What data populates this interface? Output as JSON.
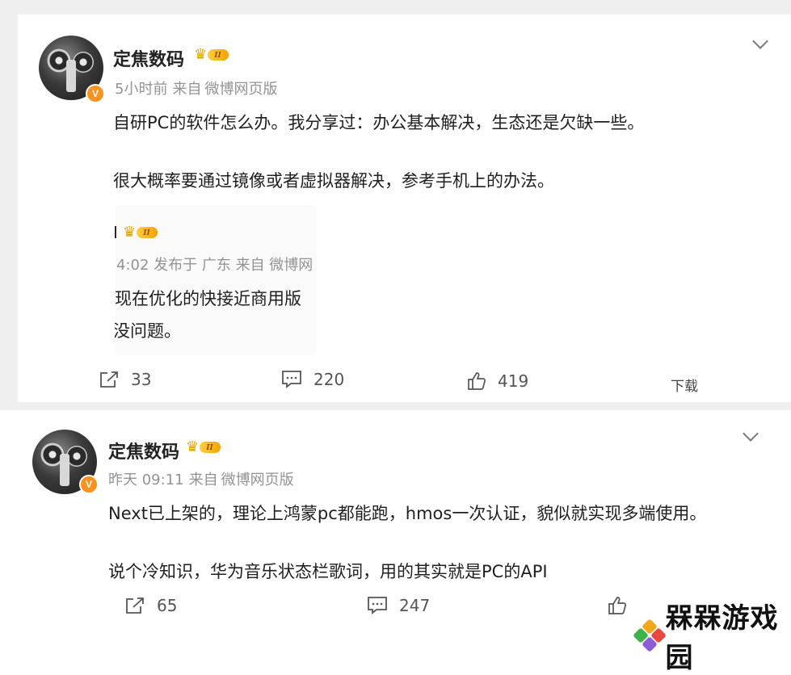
{
  "posts": [
    {
      "author": "定焦数码",
      "vip_level": "II",
      "time": "5小时前",
      "source_prefix": "来自",
      "source": "微博网页版",
      "paragraphs": [
        "自研PC的软件怎么办。我分享过：办公基本解决，生态还是欠缺一些。",
        "很大概率要通过镜像或者虚拟器解决，参考手机上的办法。"
      ],
      "quote": {
        "name_fragment": "I",
        "vip_level": "II",
        "meta": "4:02 发布于 广东 来自 微博网",
        "lines": [
          " 现在优化的快接近商用版",
          "没问题。"
        ]
      },
      "reposts": "33",
      "comments": "220",
      "likes": "419",
      "download_label": "下载"
    },
    {
      "author": "定焦数码",
      "vip_level": "II",
      "time": "昨天 09:11",
      "source_prefix": "来自",
      "source": "微博网页版",
      "paragraphs": [
        "Next已上架的，理论上鸿蒙pc都能跑，hmos一次认证，貌似就实现多端使用。",
        "说个冷知识，华为音乐状态栏歌词，用的其实就是PC的API"
      ],
      "reposts": "65",
      "comments": "247"
    }
  ],
  "watermark": "槑槑游戏园",
  "colors": {
    "badge": "#f7931e",
    "crown": "#f3a300",
    "meta": "#939393",
    "background_band": "#efefef"
  }
}
